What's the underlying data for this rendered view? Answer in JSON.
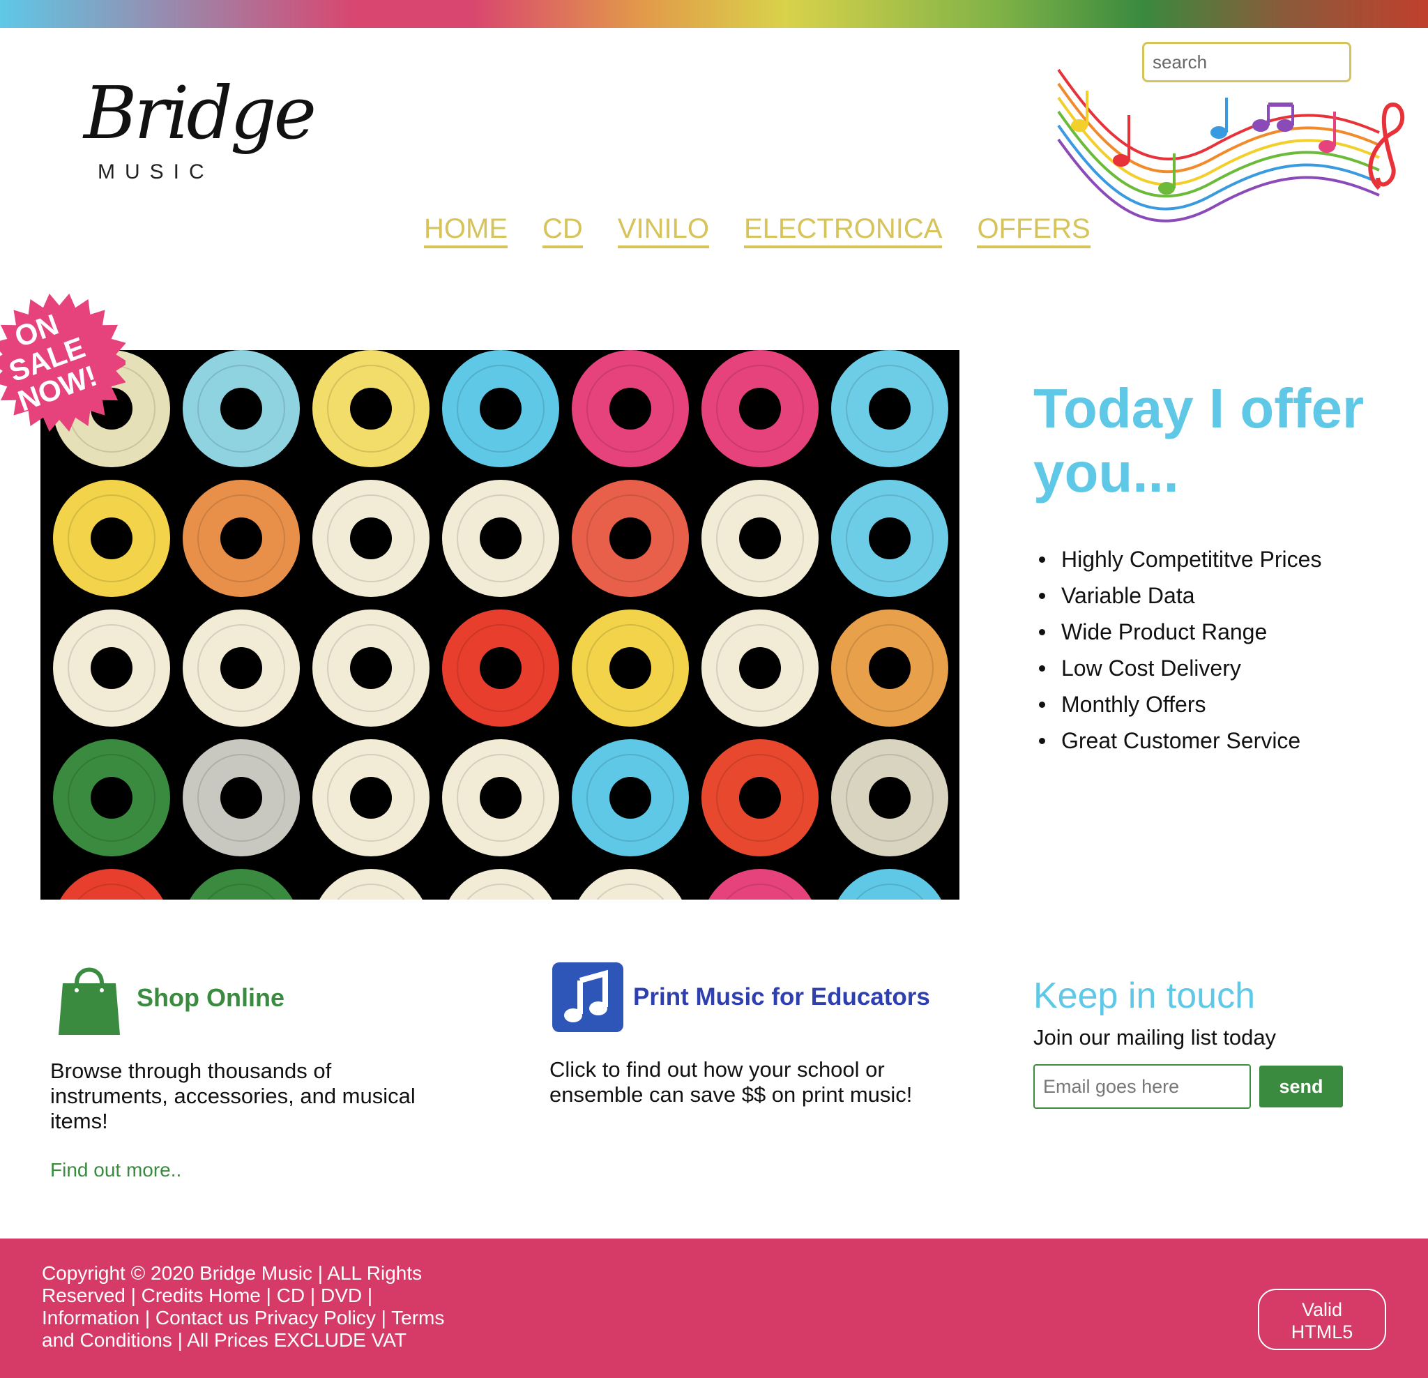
{
  "brand": {
    "logo_script": "Bridge",
    "logo_sub": "MUSIC"
  },
  "search": {
    "placeholder": "search"
  },
  "nav": {
    "items": [
      {
        "label": "HOME"
      },
      {
        "label": "CD"
      },
      {
        "label": "VINILO"
      },
      {
        "label": "ELECTRONICA"
      },
      {
        "label": "OFFERS"
      }
    ]
  },
  "hero": {
    "sale_badge": [
      "ON",
      "SALE",
      "NOW!"
    ],
    "record_label_colors": [
      [
        "#e6e0b8",
        "#8fd3e0",
        "#f2dc6a",
        "#5ec8e6",
        "#e6427c",
        "#e6427c",
        "#6ecde6"
      ],
      [
        "#f2d34a",
        "#e8904a",
        "#f2ecd6",
        "#f2ecd6",
        "#e8604a",
        "#f2ecd6",
        "#6ecde6"
      ],
      [
        "#f2ecd6",
        "#f2ecd6",
        "#f2ecd6",
        "#e83e2e",
        "#f2d34a",
        "#f2ecd6",
        "#e8a04a"
      ],
      [
        "#3a8a3f",
        "#c8c8c0",
        "#f2ecd6",
        "#f2ecd6",
        "#5ec8e6",
        "#e8482e",
        "#d8d4c0"
      ],
      [
        "#e83e2e",
        "#3a8a3f",
        "#f2ecd6",
        "#f2ecd6",
        "#f2ecd6",
        "#e6427c",
        "#5ec8e6"
      ]
    ]
  },
  "offer": {
    "title": "Today I offer you...",
    "items": [
      "Highly Competititve Prices",
      "Variable Data",
      "Wide Product Range",
      "Low Cost Delivery",
      "Monthly Offers",
      "Great Customer Service"
    ]
  },
  "shop": {
    "title": "Shop Online",
    "text": "Browse through thousands of instruments, accessories, and musical items!",
    "link": "Find out more.."
  },
  "educators": {
    "title": "Print Music for Educators",
    "text": "Click to find out how your school or ensemble can save $$ on print music!"
  },
  "touch": {
    "title": "Keep in touch",
    "subtitle": "Join our mailing list today",
    "email_placeholder": "Email goes here",
    "send_label": "send"
  },
  "footer": {
    "copyright": "Copyright © 2020 Bridge Music | ALL Rights Reserved | ",
    "links": [
      "Credits",
      "Home",
      "CD",
      "DVD",
      "Information",
      "Contact us",
      "Privacy Policy",
      "Terms and Conditions"
    ],
    "vat": "All Prices EXCLUDE VAT",
    "valid_badge": [
      "Valid",
      "HTML5"
    ]
  },
  "colors": {
    "accent_gold": "#d6c35a",
    "accent_cyan": "#5ec8e6",
    "accent_green": "#3a8a3f",
    "accent_blue": "#2e3fb0",
    "footer_pink": "#d63b68"
  }
}
